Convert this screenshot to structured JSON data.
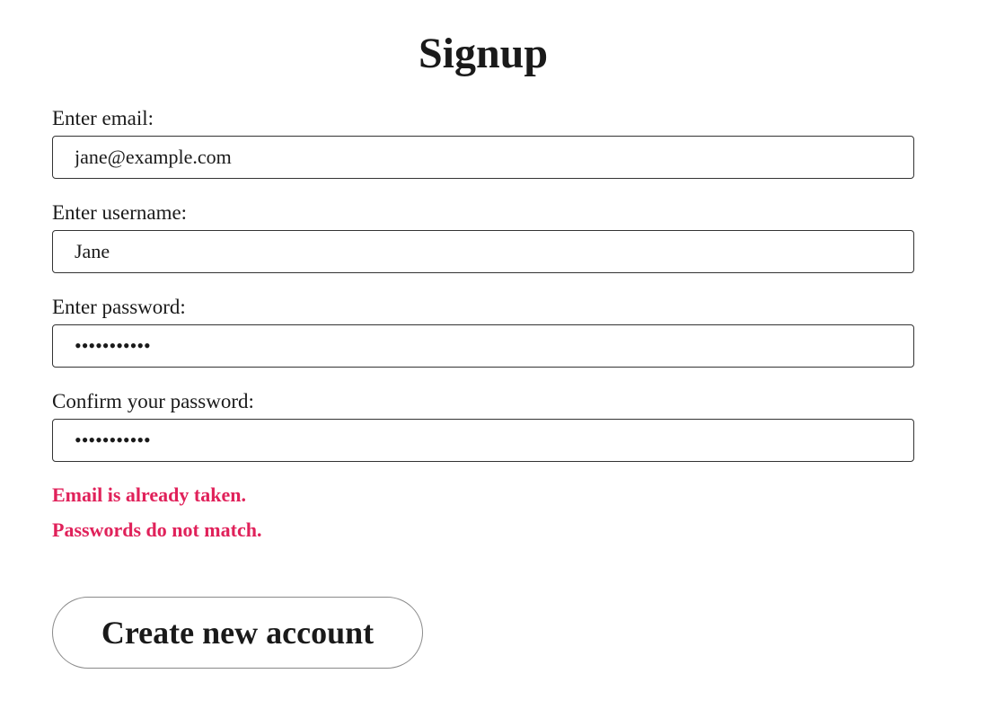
{
  "page": {
    "title": "Signup"
  },
  "form": {
    "email": {
      "label": "Enter email:",
      "value": "jane@example.com"
    },
    "username": {
      "label": "Enter username:",
      "value": "Jane"
    },
    "password": {
      "label": "Enter password:",
      "value": "•••••••••••"
    },
    "confirm_password": {
      "label": "Confirm your password:",
      "value": "•••••••••••"
    },
    "errors": [
      "Email is already taken.",
      "Passwords do not match."
    ],
    "submit_label": "Create new account"
  },
  "colors": {
    "error": "#e0215a",
    "text": "#1a1a1a",
    "background": "#ffffff"
  }
}
